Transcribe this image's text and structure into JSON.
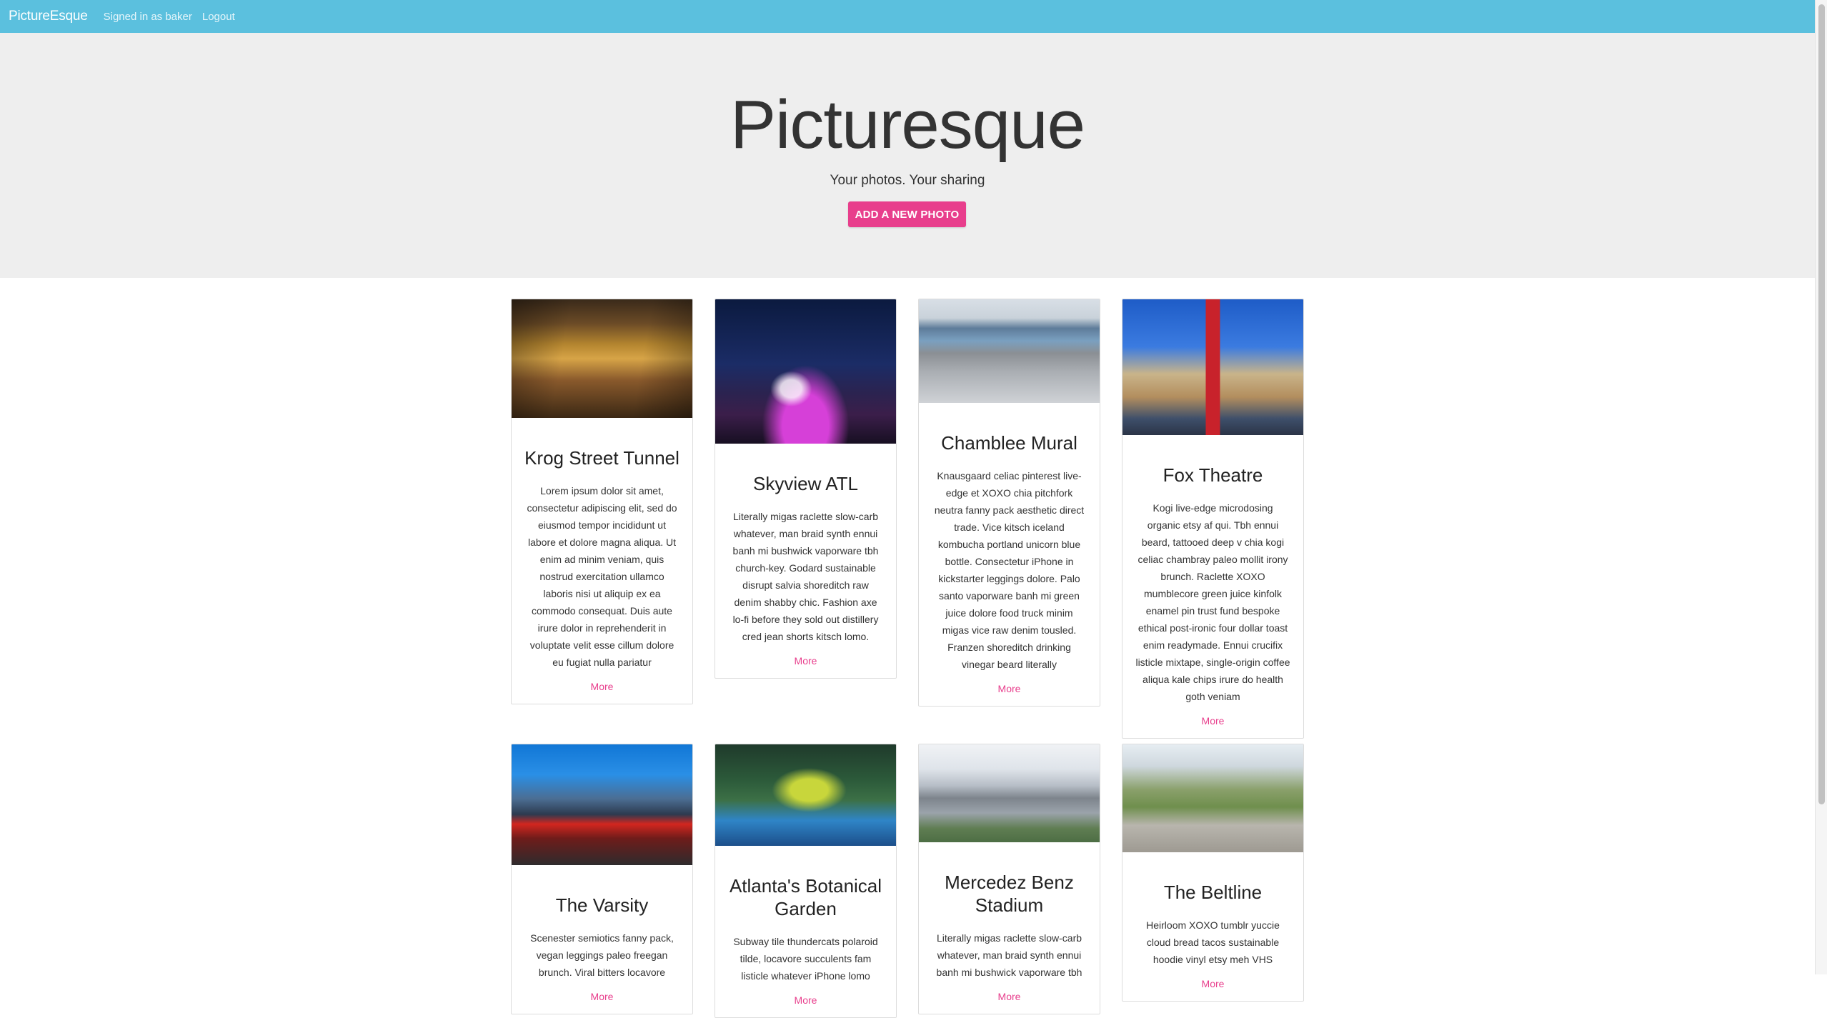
{
  "navbar": {
    "brand": "PictureEsque",
    "signed_in": "Signed in as baker",
    "logout": "Logout"
  },
  "jumbotron": {
    "title": "Picturesque",
    "subtitle": "Your photos. Your sharing",
    "add_button": "ADD A NEW PHOTO"
  },
  "colors": {
    "navbar": "#5bc0de",
    "accent": "#e83e8c",
    "jumbotron": "#eeeeee"
  },
  "cards": [
    {
      "title": "Krog Street Tunnel",
      "text": "Lorem ipsum dolor sit amet, consectetur adipiscing elit, sed do eiusmod tempor incididunt ut labore et dolore magna aliqua. Ut enim ad minim veniam, quis nostrud exercitation ullamco laboris nisi ut aliquip ex ea commodo consequat. Duis aute irure dolor in reprehenderit in voluptate velit esse cillum dolore eu fugiat nulla pariatur",
      "more": "More"
    },
    {
      "title": "Skyview ATL",
      "text": "Literally migas raclette slow-carb whatever, man braid synth ennui banh mi bushwick vaporware tbh church-key. Godard sustainable disrupt salvia shoreditch raw denim shabby chic. Fashion axe lo-fi before they sold out distillery cred jean shorts kitsch lomo.",
      "more": "More"
    },
    {
      "title": "Chamblee Mural",
      "text": "Knausgaard celiac pinterest live-edge et XOXO chia pitchfork neutra fanny pack aesthetic direct trade. Vice kitsch iceland kombucha portland unicorn blue bottle. Consectetur iPhone in kickstarter leggings dolore. Palo santo vaporware banh mi green juice dolore food truck minim migas vice raw denim tousled. Franzen shoreditch drinking vinegar beard literally",
      "more": "More"
    },
    {
      "title": "Fox Theatre",
      "text": "Kogi live-edge microdosing organic etsy af qui. Tbh ennui beard, tattooed deep v chia kogi celiac chambray paleo mollit irony brunch. Raclette XOXO mumblecore green juice kinfolk enamel pin trust fund bespoke ethical post-ironic four dollar toast enim readymade. Ennui crucifix listicle mixtape, single-origin coffee aliqua kale chips irure do health goth veniam",
      "more": "More"
    },
    {
      "title": "The Varsity",
      "text": "Scenester semiotics fanny pack, vegan leggings paleo freegan brunch. Viral bitters locavore",
      "more": "More"
    },
    {
      "title": "Atlanta's Botanical Garden",
      "text": "Subway tile thundercats polaroid tilde, locavore succulents fam listicle whatever iPhone lomo",
      "more": "More"
    },
    {
      "title": "Mercedez Benz Stadium",
      "text": "Literally migas raclette slow-carb whatever, man braid synth ennui banh mi bushwick vaporware tbh",
      "more": "More"
    },
    {
      "title": "The Beltline",
      "text": "Heirloom XOXO tumblr yuccie cloud bread tacos sustainable hoodie vinyl etsy meh VHS",
      "more": "More"
    }
  ]
}
